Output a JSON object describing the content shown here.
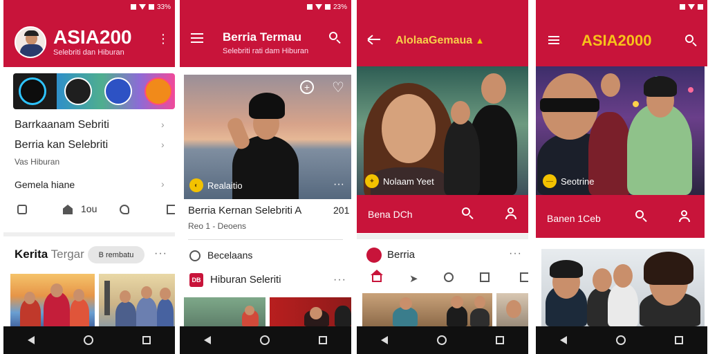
{
  "status": {
    "p1": "33%",
    "p2": "23%"
  },
  "screen1": {
    "title": "ASIA200",
    "subtitle": "Selebriti dan Hiburan",
    "row1": "Barrkaanam Sebriti",
    "row2": "Berria kan Selebriti",
    "row2_sub": "Vas Hiburan",
    "row3": "Gemela hiane",
    "count": "1ou",
    "section": "Kerita",
    "section_light": "Tergar",
    "chip": "B rembatu"
  },
  "screen2": {
    "title": "Berria Termau",
    "subtitle": "Selebriti rati dam Hiburan",
    "photo_caption": "Realaitio",
    "headline": "Berria  Kernan Selebriti  A",
    "headline_num": "201",
    "meta": "Reo 1 - Deoens",
    "row1": "Becelaans",
    "row2": "Hiburan Seleriti",
    "row2_badge": "DB"
  },
  "screen3": {
    "title": "AlolaaGemaua",
    "photo_caption": "Nolaam Yeet",
    "footer_text": "Bena  DCh",
    "row1": "Berria"
  },
  "screen4": {
    "title": "ASIA2000",
    "photo_caption": "Seotrine",
    "footer_text": "Banen  1Ceb"
  },
  "colors": {
    "primary": "#c8143a",
    "accent": "#f3c200"
  },
  "icons": [
    "menu-icon",
    "search-icon",
    "back-arrow-icon",
    "user-icon",
    "heart-icon",
    "home-icon",
    "send-icon",
    "tag-icon",
    "edit-icon",
    "more-icon"
  ]
}
